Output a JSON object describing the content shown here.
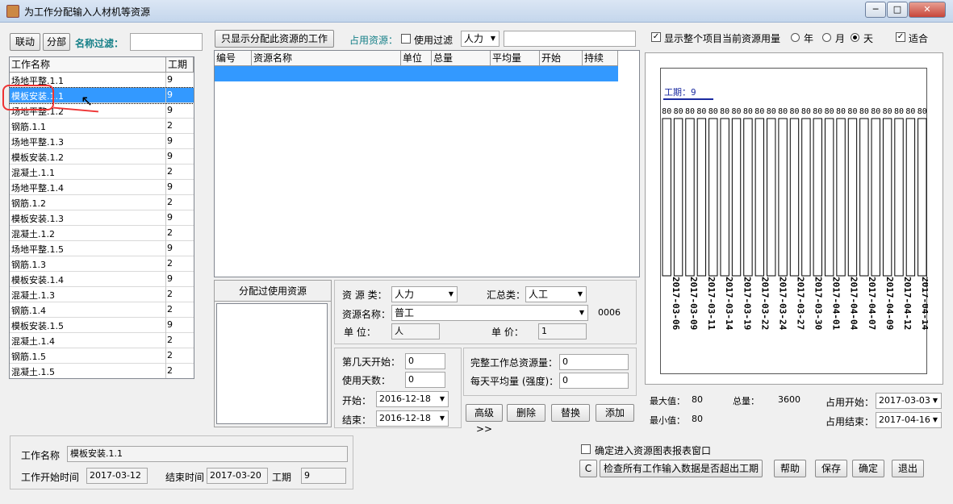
{
  "window": {
    "title": "为工作分配输入人材机等资源",
    "minimize": "─",
    "maximize": "□",
    "close": "✕"
  },
  "left": {
    "btn_link": "联动",
    "btn_split": "分部",
    "filter_label": "名称过滤：",
    "filter_value": "",
    "col_name": "工作名称",
    "col_dur": "工期",
    "rows": [
      {
        "name": "场地平整.1.1",
        "dur": "9"
      },
      {
        "name": "模板安装.1.1",
        "dur": "9"
      },
      {
        "name": "场地平整.1.2",
        "dur": "9"
      },
      {
        "name": "钢筋.1.1",
        "dur": "2"
      },
      {
        "name": "场地平整.1.3",
        "dur": "9"
      },
      {
        "name": "模板安装.1.2",
        "dur": "9"
      },
      {
        "name": "混凝土.1.1",
        "dur": "2"
      },
      {
        "name": "场地平整.1.4",
        "dur": "9"
      },
      {
        "name": "钢筋.1.2",
        "dur": "2"
      },
      {
        "name": "模板安装.1.3",
        "dur": "9"
      },
      {
        "name": "混凝土.1.2",
        "dur": "2"
      },
      {
        "name": "场地平整.1.5",
        "dur": "9"
      },
      {
        "name": "钢筋.1.3",
        "dur": "2"
      },
      {
        "name": "模板安装.1.4",
        "dur": "9"
      },
      {
        "name": "混凝土.1.3",
        "dur": "2"
      },
      {
        "name": "钢筋.1.4",
        "dur": "2"
      },
      {
        "name": "模板安装.1.5",
        "dur": "9"
      },
      {
        "name": "混凝土.1.4",
        "dur": "2"
      },
      {
        "name": "钢筋.1.5",
        "dur": "2"
      },
      {
        "name": "混凝土.1.5",
        "dur": "2"
      }
    ],
    "selected_index": 1
  },
  "middle": {
    "btn_show_only": "只显示分配此资源的工作",
    "occupy_label": "占用资源：",
    "use_filter_label": "使用过滤",
    "type_select": "人力",
    "filter_text": "",
    "cols": [
      "编号",
      "资源名称",
      "单位",
      "总量",
      "平均量",
      "开始",
      "持续"
    ],
    "used_title": "分配过使用资源",
    "res_type_label": "资 源 类：",
    "res_type_value": "人力",
    "sum_type_label": "汇总类：",
    "sum_type_value": "人工",
    "res_name_label": "资源名称：",
    "res_name_value": "普工",
    "res_code": "0006",
    "unit_label": "单  位：",
    "unit_value": "人",
    "price_label": "单  价：",
    "price_value": "1",
    "start_day_label": "第几天开始：",
    "start_day_value": "0",
    "use_days_label": "使用天数：",
    "use_days_value": "0",
    "start_label": "开始：",
    "start_value": "2016-12-18",
    "end_label": "结束：",
    "end_value": "2016-12-18",
    "total_label": "完整工作总资源量：",
    "total_value": "0",
    "daily_label": "每天平均量 (强度)：",
    "daily_value": "0",
    "btn_advanced": "高级>>",
    "btn_delete": "删除",
    "btn_replace": "替换",
    "btn_add": "添加"
  },
  "right": {
    "show_whole_label": "显示整个项目当前资源用量",
    "radio_year": "年",
    "radio_month": "月",
    "radio_day": "天",
    "fit_label": "适合",
    "duration_label": "工期：9",
    "bar_value": "80",
    "bar_count": 23,
    "dates": [
      "2017-03-06",
      "2017-03-09",
      "2017-03-11",
      "2017-03-14",
      "2017-03-19",
      "2017-03-22",
      "2017-03-24",
      "2017-03-27",
      "2017-03-30",
      "2017-04-01",
      "2017-04-04",
      "2017-04-07",
      "2017-04-09",
      "2017-04-12",
      "2017-04-14"
    ],
    "max_label": "最大值：",
    "max_value": "80",
    "min_label": "最小值：",
    "min_value": "80",
    "total_label": "总量：",
    "total_value": "3600",
    "occ_start_label": "占用开始：",
    "occ_start_value": "2017-03-03",
    "occ_end_label": "占用结束：",
    "occ_end_value": "2017-04-16"
  },
  "bottom": {
    "work_name_label": "工作名称",
    "work_name_value": "模板安装.1.1",
    "start_label": "工作开始时间",
    "start_value": "2017-03-12",
    "end_label": "结束时间",
    "end_value": "2017-03-20",
    "dur_label": "工期",
    "dur_value": "9",
    "enter_chart_label": "确定进入资源图表报表窗口",
    "btn_c": "C",
    "btn_check": "检查所有工作输入数据是否超出工期",
    "btn_help": "帮助",
    "btn_save": "保存",
    "btn_ok": "确定",
    "btn_exit": "退出"
  }
}
